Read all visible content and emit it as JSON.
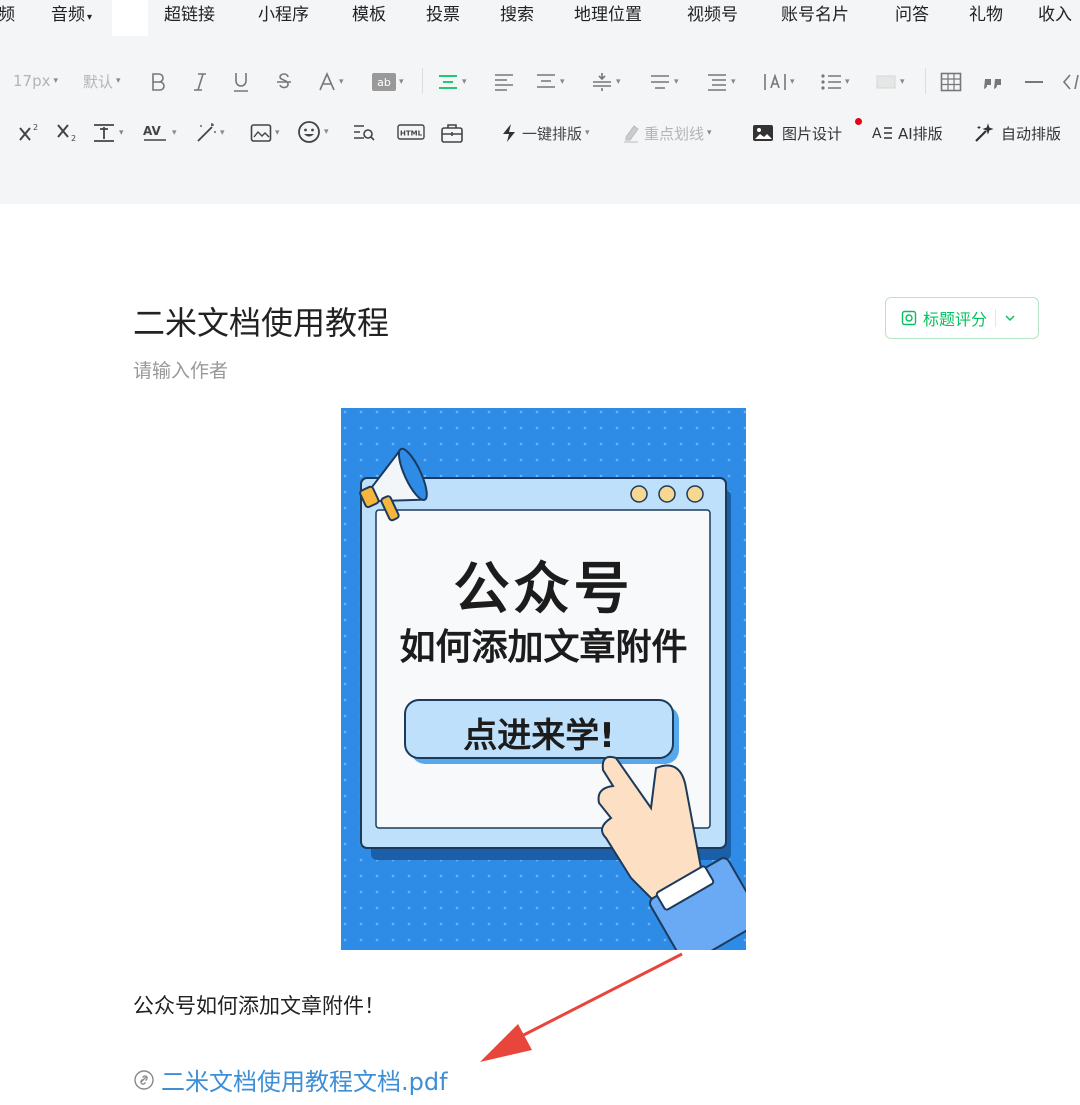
{
  "menu": {
    "items": [
      "频",
      "音频",
      "超链接",
      "小程序",
      "模板",
      "投票",
      "搜索",
      "地理位置",
      "视频号",
      "账号名片",
      "问答",
      "礼物",
      "收入"
    ],
    "audio_caret": "▾"
  },
  "toolbar": {
    "font_size": "17px",
    "font_default": "默认",
    "one_key_layout": "一键排版",
    "highlight_line": "重点划线",
    "image_design": "图片设计",
    "ai_layout": "AI排版",
    "auto_layout": "自动排版"
  },
  "article": {
    "title": "二米文档使用教程",
    "author_placeholder": "请输入作者",
    "score_button": "标题评分",
    "poster": {
      "line1": "公众号",
      "line2": "如何添加文章附件",
      "button": "点进来学!"
    },
    "paragraph": "公众号如何添加文章附件！",
    "attachment": "二米文档使用教程文档.pdf"
  },
  "colors": {
    "accent_green": "#07c160",
    "link_blue": "#3f8fd6",
    "poster_blue": "#2e8be6",
    "arrow_red": "#e8453c"
  },
  "icons": [
    "bold-icon",
    "italic-icon",
    "underline-icon",
    "strikethrough-icon",
    "font-color-icon",
    "background-color-icon",
    "align-center-icon",
    "indent-icon",
    "line-height-icon",
    "list-icon",
    "table-icon",
    "quote-icon",
    "divider-icon",
    "code-icon",
    "superscript-icon",
    "subscript-icon",
    "emoji-icon",
    "html-icon",
    "lightning-icon",
    "image-icon",
    "link-icon"
  ]
}
